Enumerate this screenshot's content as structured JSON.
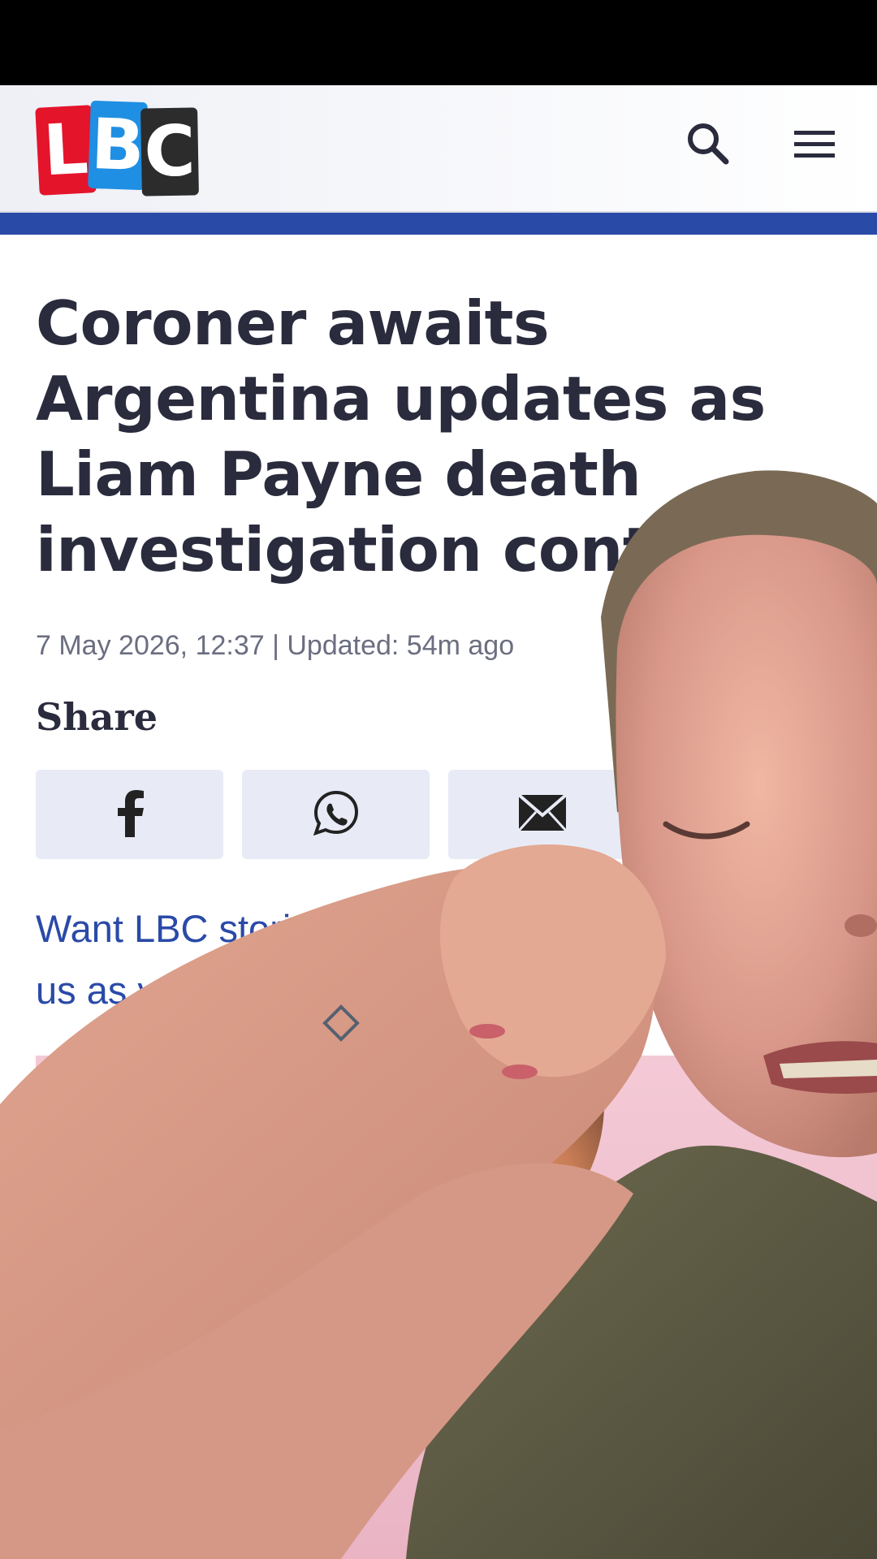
{
  "header": {
    "logo_letters": [
      "L",
      "B",
      "C"
    ],
    "icons": [
      "search-icon",
      "menu-icon"
    ]
  },
  "article": {
    "headline": "Coroner awaits Argentina updates as Liam Payne death investigation continues",
    "dateline": "7 May 2026, 12:37 | Updated: 54m ago",
    "share_label": "Share",
    "share_buttons": [
      "facebook-icon",
      "whatsapp-icon",
      "email-icon"
    ],
    "promo_line1": "Want LBC stori",
    "promo_line2": "us as your"
  },
  "colors": {
    "brand_blue": "#2a4aa8",
    "text_dark": "#2a2b3d",
    "share_bg": "#e8ebf6"
  }
}
